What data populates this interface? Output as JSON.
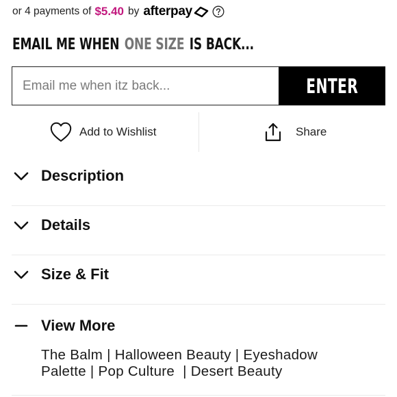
{
  "afterpay": {
    "prefix": "or 4 payments of",
    "amount": "$5.40",
    "by": "by",
    "brand": "afterpay",
    "colors": {
      "amount": "#c2187e"
    },
    "icons": [
      "afterpay-arrows-icon",
      "help-icon"
    ]
  },
  "restock": {
    "heading_before": "EMAIL ME WHEN",
    "heading_size": "ONE SIZE",
    "heading_after": "IS BACK...",
    "input_value": "",
    "input_placeholder": "Email me when itz back...",
    "submit_label": "ENTER"
  },
  "actions": {
    "wishlist_label": "Add to Wishlist",
    "wishlist_icon": "heart-icon",
    "share_label": "Share",
    "share_icon": "share-icon"
  },
  "accordion": {
    "items": [
      {
        "title": "Description",
        "state": "collapsed",
        "icon": "chevron-down-icon"
      },
      {
        "title": "Details",
        "state": "collapsed",
        "icon": "chevron-down-icon"
      },
      {
        "title": "Size & Fit",
        "state": "collapsed",
        "icon": "chevron-down-icon"
      }
    ],
    "view_more": {
      "title": "View More",
      "state": "expanded",
      "icon": "minus-icon",
      "tags": "The Balm | Halloween Beauty | Eyeshadow Palette | Pop Culture  | Desert Beauty"
    }
  }
}
